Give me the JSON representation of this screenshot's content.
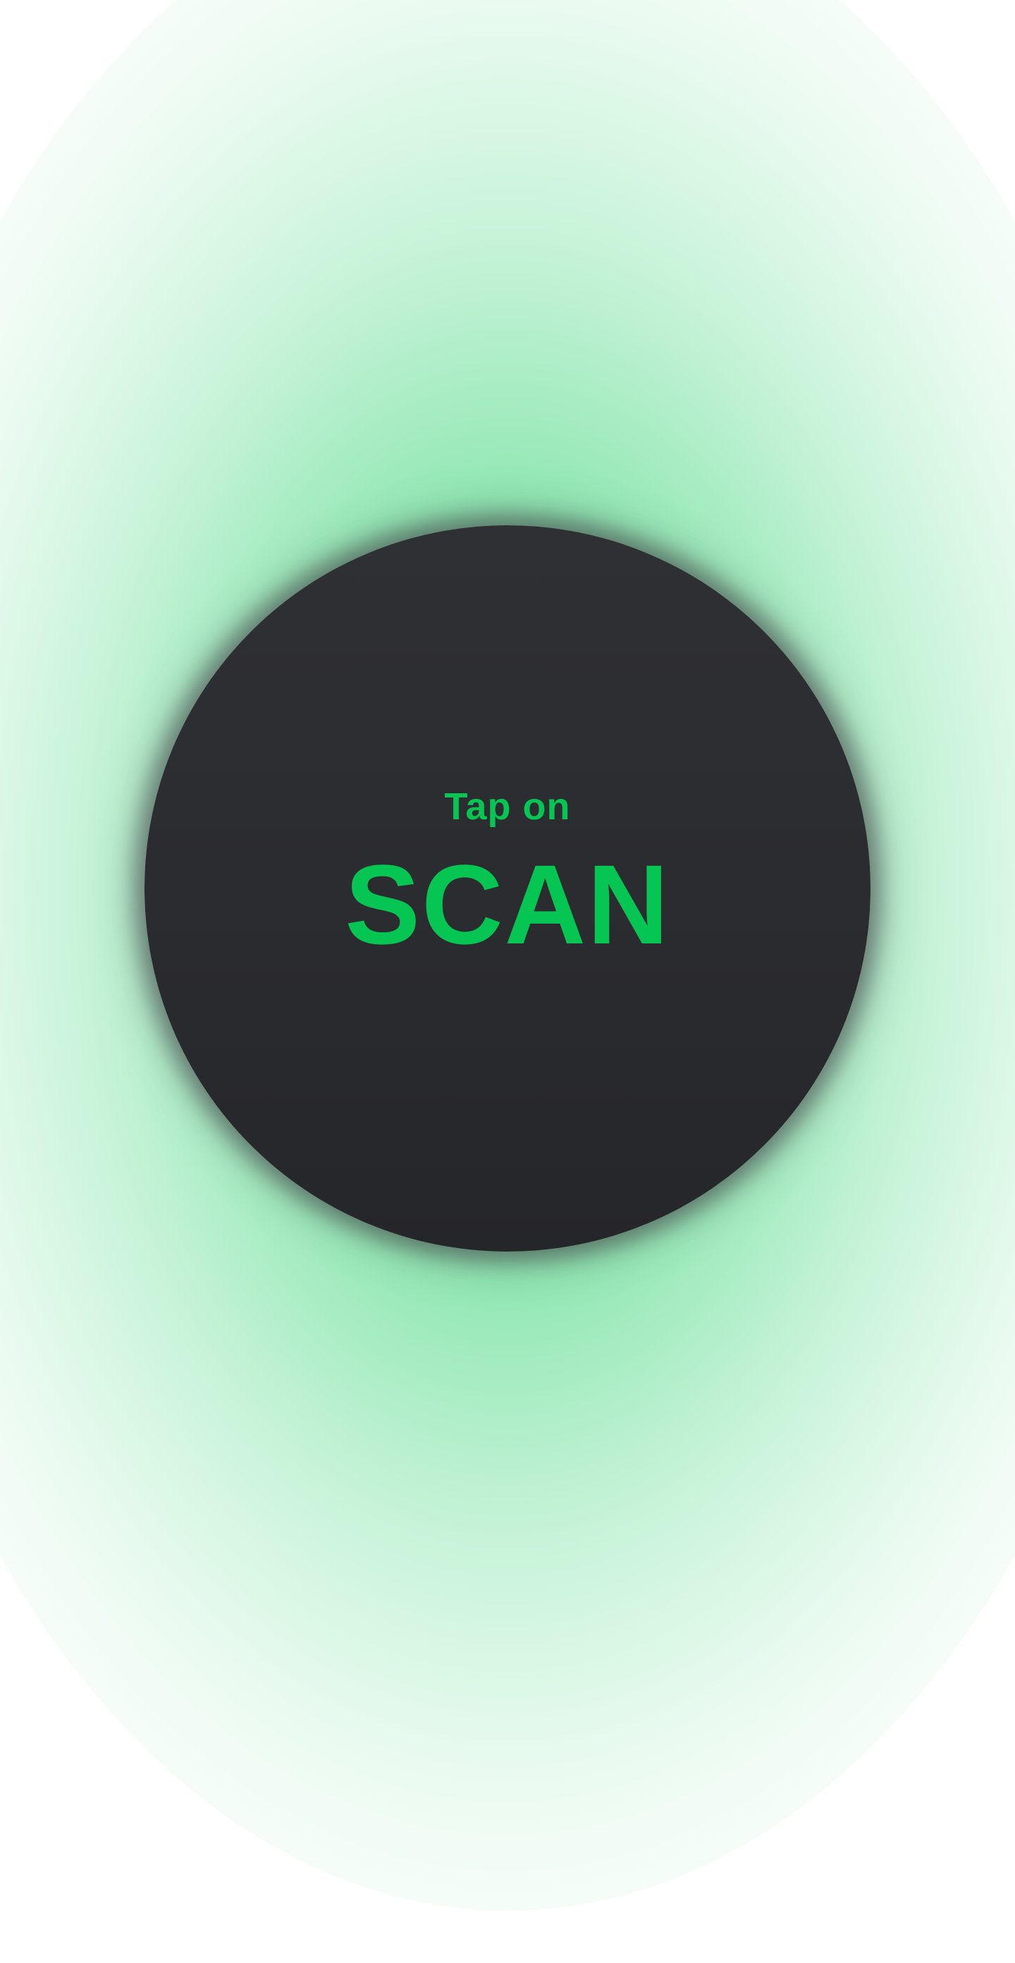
{
  "scan_button": {
    "hint_label": "Tap on",
    "action_label": "SCAN"
  },
  "colors": {
    "accent": "#05c653",
    "button_background": "#2b2c30",
    "page_background": "#ffffff",
    "glow": "#00c850"
  }
}
